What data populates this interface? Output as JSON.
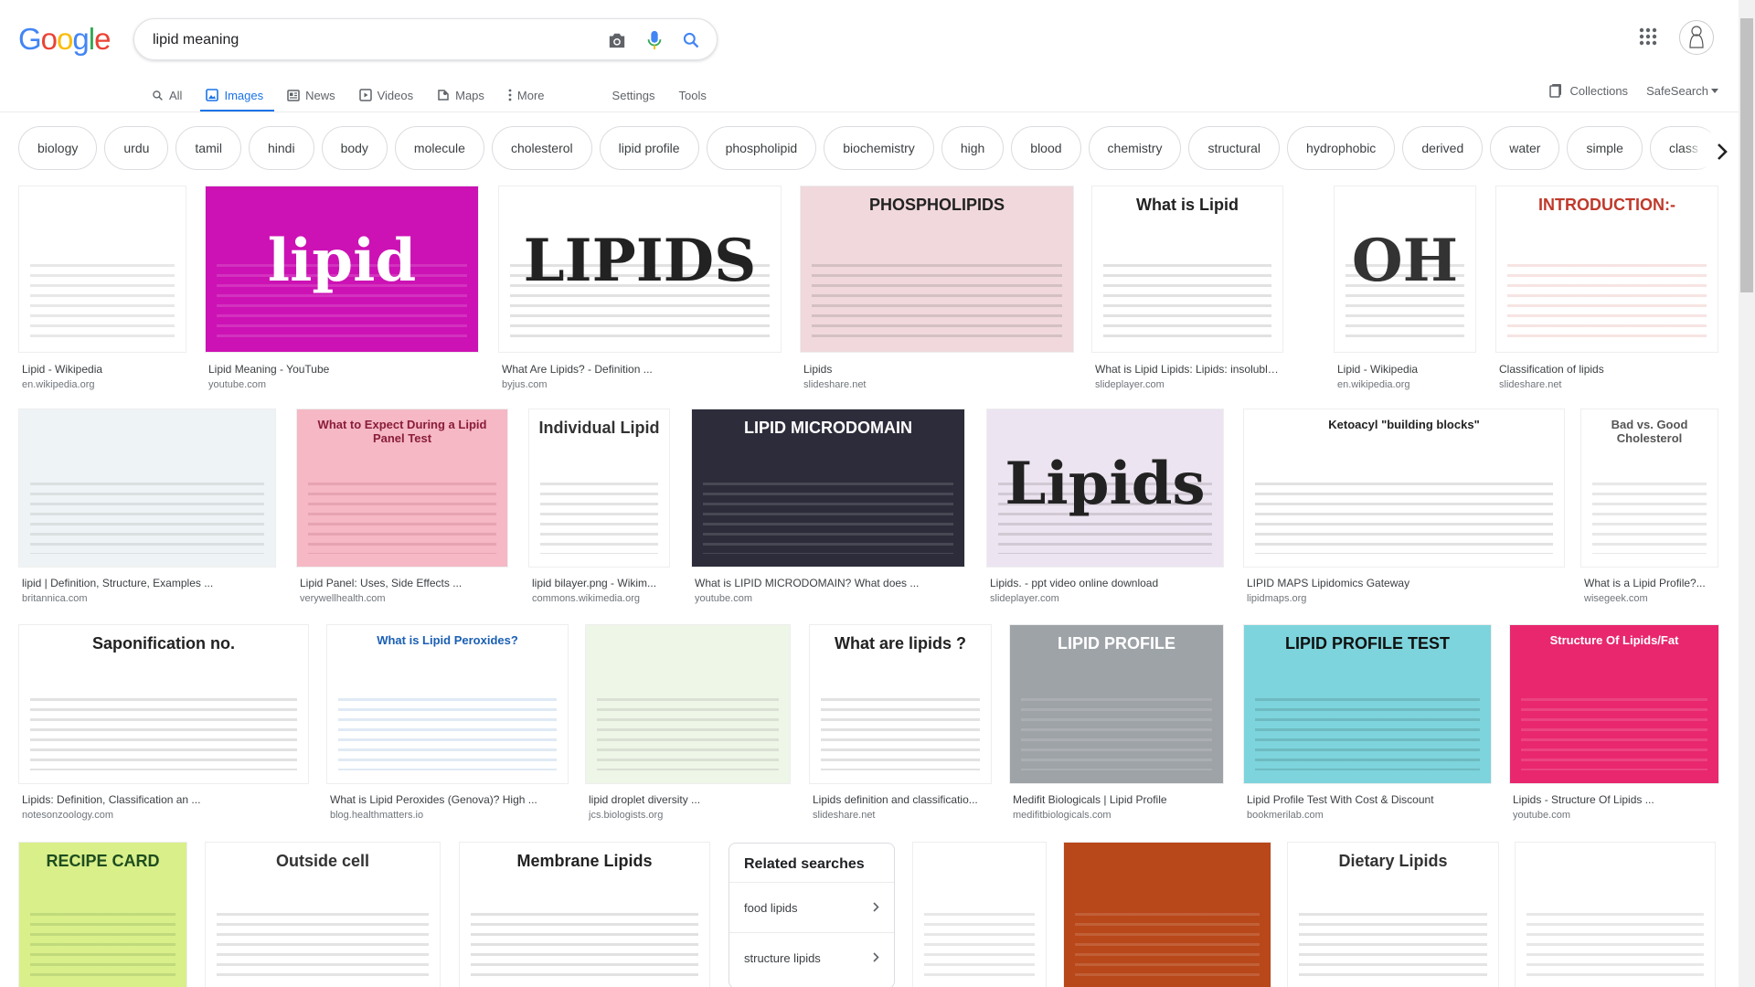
{
  "logo": {
    "letters": [
      "G",
      "o",
      "o",
      "g",
      "l",
      "e"
    ],
    "colors": [
      "#4285f4",
      "#ea4335",
      "#fbbc05",
      "#4285f4",
      "#34a853",
      "#ea4335"
    ]
  },
  "search": {
    "value": "lipid meaning"
  },
  "tabs": [
    {
      "label": "All",
      "icon": "search-icon"
    },
    {
      "label": "Images",
      "icon": "image-icon",
      "active": true
    },
    {
      "label": "News",
      "icon": "news-icon"
    },
    {
      "label": "Videos",
      "icon": "video-icon"
    },
    {
      "label": "Maps",
      "icon": "map-icon"
    },
    {
      "label": "More",
      "icon": "more-vertical-icon"
    }
  ],
  "tools": {
    "settings": "Settings",
    "tools": "Tools",
    "collections": "Collections",
    "safesearch": "SafeSearch"
  },
  "chips": [
    "biology",
    "urdu",
    "tamil",
    "hindi",
    "body",
    "molecule",
    "cholesterol",
    "lipid profile",
    "phospholipid",
    "biochemistry",
    "high",
    "blood",
    "chemistry",
    "structural",
    "hydrophobic",
    "derived",
    "water",
    "simple",
    "class"
  ],
  "results": [
    {
      "title": "Lipid - Wikipedia",
      "source": "en.wikipedia.org",
      "text": "",
      "bg": "#ffffff",
      "fg": "#555555"
    },
    {
      "title": "Lipid Meaning - YouTube",
      "source": "youtube.com",
      "text": "lipid",
      "bg": "#cc12b4",
      "fg": "#ffffff"
    },
    {
      "title": "What Are Lipids? - Definition ...",
      "source": "byjus.com",
      "text": "LIPIDS",
      "bg": "#ffffff",
      "fg": "#222222"
    },
    {
      "title": "Lipids",
      "source": "slideshare.net",
      "text": "PHOSPHOLIPIDS",
      "bg": "#f0d8dc",
      "fg": "#222222"
    },
    {
      "title": "What is Lipid Lipids: Lipids: insoluble ...",
      "source": "slideplayer.com",
      "text": "What is Lipid",
      "bg": "#ffffff",
      "fg": "#222222"
    },
    {
      "title": "Lipid - Wikipedia",
      "source": "en.wikipedia.org",
      "text": "OH",
      "bg": "#ffffff",
      "fg": "#333333"
    },
    {
      "title": "Classification of lipids",
      "source": "slideshare.net",
      "text": "INTRODUCTION:-",
      "bg": "#ffffff",
      "fg": "#c0392b"
    },
    {
      "title": "lipid | Definition, Structure, Examples ...",
      "source": "britannica.com",
      "text": "",
      "bg": "#eef4f6",
      "fg": "#555555"
    },
    {
      "title": "Lipid Panel: Uses, Side Effects ...",
      "source": "verywellhealth.com",
      "text": "What to Expect During a Lipid Panel Test",
      "bg": "#f5b8c4",
      "fg": "#8a1c3a"
    },
    {
      "title": "lipid bilayer.png - Wikim...",
      "source": "commons.wikimedia.org",
      "text": "Individual Lipid",
      "bg": "#ffffff",
      "fg": "#333333"
    },
    {
      "title": "What is LIPID MICRODOMAIN? What does ...",
      "source": "youtube.com",
      "text": "LIPID MICRODOMAIN",
      "bg": "#2c2c3a",
      "fg": "#ffffff"
    },
    {
      "title": "Lipids. - ppt video online download",
      "source": "slideplayer.com",
      "text": "Lipids",
      "bg": "#ece4f0",
      "fg": "#222222"
    },
    {
      "title": "LIPID MAPS Lipidomics Gateway",
      "source": "lipidmaps.org",
      "text": "Ketoacyl \"building blocks\"",
      "bg": "#ffffff",
      "fg": "#222222"
    },
    {
      "title": "What is a Lipid Profile?...",
      "source": "wisegeek.com",
      "text": "Bad vs. Good Cholesterol",
      "bg": "#ffffff",
      "fg": "#555555"
    },
    {
      "title": "Lipids: Definition, Classification an ...",
      "source": "notesonzoology.com",
      "text": "Saponification no.",
      "bg": "#ffffff",
      "fg": "#222222"
    },
    {
      "title": "What is Lipid Peroxides (Genova)? High ...",
      "source": "blog.healthmatters.io",
      "text": "What is Lipid Peroxides?",
      "bg": "#ffffff",
      "fg": "#1a5fb4"
    },
    {
      "title": "lipid droplet diversity ...",
      "source": "jcs.biologists.org",
      "text": "",
      "bg": "#eef6e8",
      "fg": "#555555"
    },
    {
      "title": "Lipids definition and classificatio...",
      "source": "slideshare.net",
      "text": "What are lipids ?",
      "bg": "#ffffff",
      "fg": "#222222"
    },
    {
      "title": "Medifit Biologicals | Lipid Profile",
      "source": "medifitbiologicals.com",
      "text": "LIPID PROFILE",
      "bg": "#9ea3a8",
      "fg": "#ffffff"
    },
    {
      "title": "Lipid Profile Test With Cost & Discount",
      "source": "bookmerilab.com",
      "text": "LIPID PROFILE TEST",
      "bg": "#7dd4dc",
      "fg": "#111111"
    },
    {
      "title": "Lipids - Structure Of Lipids ...",
      "source": "youtube.com",
      "text": "Structure Of Lipids/Fat",
      "bg": "#e8276e",
      "fg": "#ffffff"
    },
    {
      "title": "",
      "source": "",
      "text": "RECIPE CARD",
      "bg": "#d9ef8a",
      "fg": "#1e4d1e"
    },
    {
      "title": "",
      "source": "",
      "text": "Outside cell",
      "bg": "#ffffff",
      "fg": "#333333"
    },
    {
      "title": "",
      "source": "",
      "text": "Membrane Lipids",
      "bg": "#ffffff",
      "fg": "#222222"
    },
    {
      "title": "",
      "source": "",
      "text": "",
      "bg": "#ffffff",
      "fg": "#555555"
    },
    {
      "title": "",
      "source": "",
      "text": "",
      "bg": "#b8471a",
      "fg": "#ffffff"
    },
    {
      "title": "",
      "source": "",
      "text": "Dietary Lipids",
      "bg": "#ffffff",
      "fg": "#333333"
    },
    {
      "title": "",
      "source": "",
      "text": "",
      "bg": "#ffffff",
      "fg": "#555555"
    }
  ],
  "related": {
    "heading": "Related searches",
    "items": [
      "food lipids",
      "structure lipids"
    ]
  }
}
